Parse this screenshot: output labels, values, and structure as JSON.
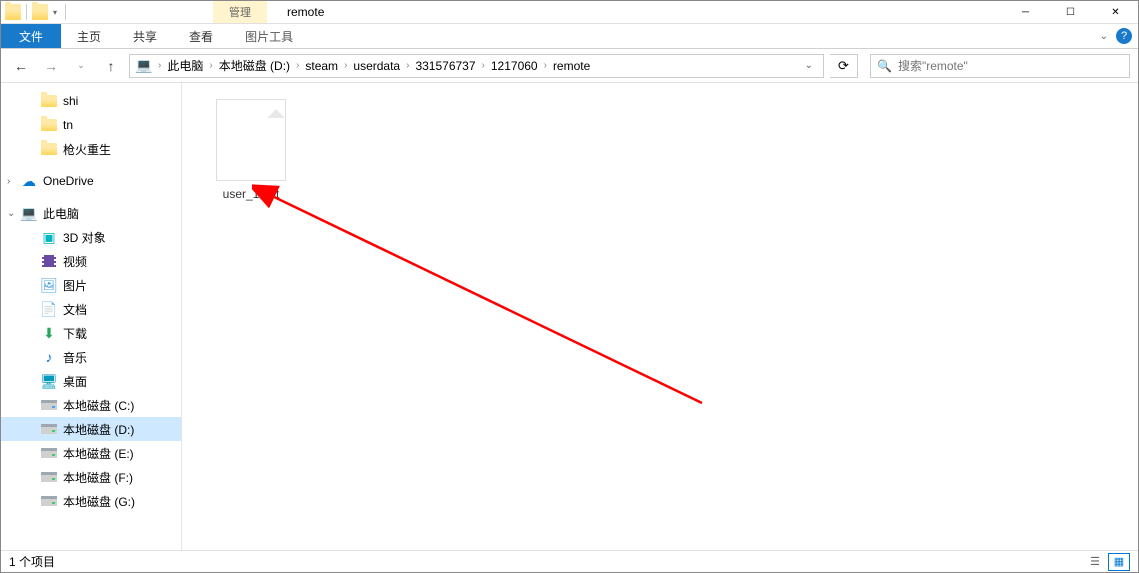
{
  "title": "remote",
  "manage_tab": "管理",
  "ribbon": {
    "file": "文件",
    "home": "主页",
    "share": "共享",
    "view": "查看",
    "tool": "图片工具"
  },
  "breadcrumb": {
    "items": [
      "此电脑",
      "本地磁盘 (D:)",
      "steam",
      "userdata",
      "331576737",
      "1217060",
      "remote"
    ]
  },
  "search": {
    "placeholder": "搜索\"remote\""
  },
  "sidebar": {
    "shi": "shi",
    "tn": "tn",
    "qhcs": "枪火重生",
    "onedrive": "OneDrive",
    "pc": "此电脑",
    "pc_children": {
      "obj3d": "3D 对象",
      "video": "视频",
      "pictures": "图片",
      "docs": "文档",
      "downloads": "下载",
      "music": "音乐",
      "desktop": "桌面",
      "drive_c": "本地磁盘 (C:)",
      "drive_d": "本地磁盘 (D:)",
      "drive_e": "本地磁盘 (E:)",
      "drive_f": "本地磁盘 (F:)",
      "drive_g": "本地磁盘 (G:)"
    }
  },
  "file": {
    "name": "user_1.dat"
  },
  "statusbar": {
    "count": "1 个项目"
  }
}
